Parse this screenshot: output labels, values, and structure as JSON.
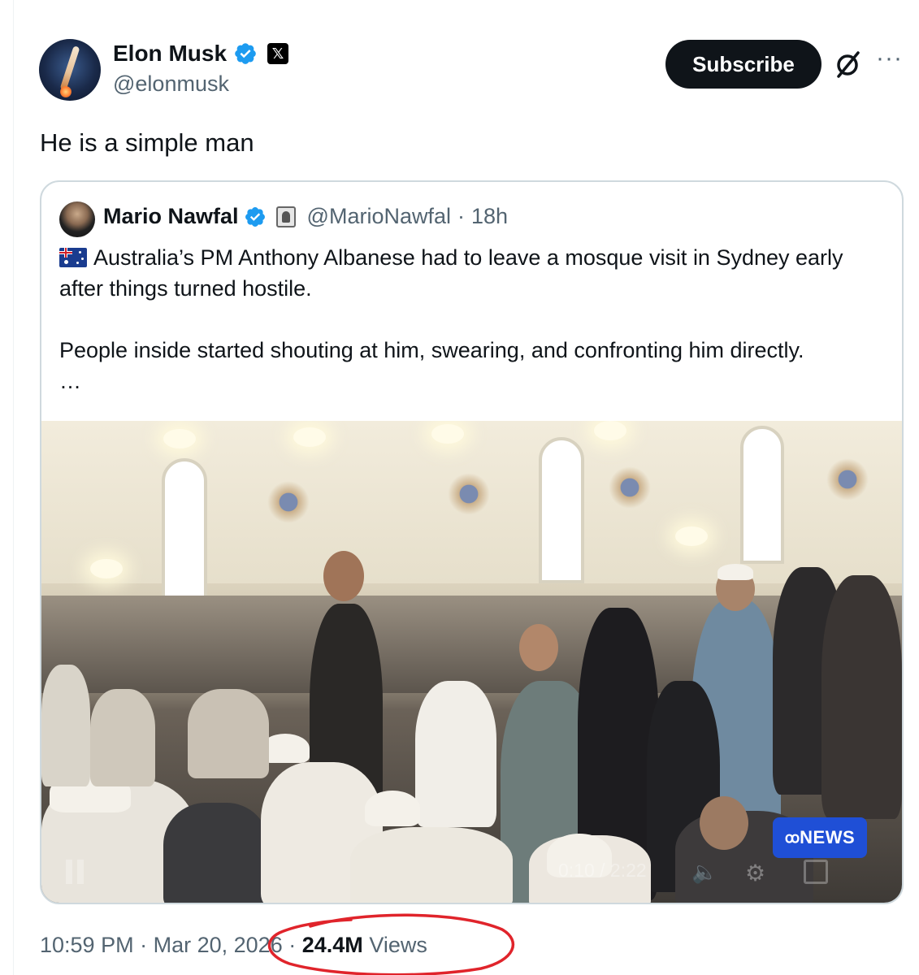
{
  "author": {
    "display_name": "Elon Musk",
    "handle": "@elonmusk",
    "affiliation_badge": "𝕏",
    "verified_icon": "verified-badge-icon"
  },
  "actions": {
    "subscribe_label": "Subscribe",
    "grok_icon": "grok-icon",
    "more_label": "···"
  },
  "tweet": {
    "text": "He is a simple man"
  },
  "quoted": {
    "display_name": "Mario Nawfal",
    "handle": "@MarioNawfal",
    "separator": "·",
    "time": "18h",
    "flag_icon": "australia-flag-icon",
    "paragraph1": "Australia’s PM Anthony Albanese had to leave a mosque visit in Sydney early after things turned hostile.",
    "paragraph2": "People inside started shouting at him, swearing, and confronting him directly.",
    "ellipsis": "…",
    "video": {
      "watermark": "NEWS",
      "watermark_logo": "ꝏ",
      "time_display": "0:10 / 2:22"
    }
  },
  "meta": {
    "time": "10:59 PM",
    "sep1": "·",
    "date": "Mar 20, 2026",
    "sep2": "·",
    "views_count": "24.4M",
    "views_label": "Views"
  },
  "colors": {
    "accent_verified": "#1d9bf0",
    "text_primary": "#0f1419",
    "text_secondary": "#536471",
    "border": "#cfd9de",
    "annotation_red": "#e0242b",
    "abc_blue": "#1f4fd6"
  }
}
